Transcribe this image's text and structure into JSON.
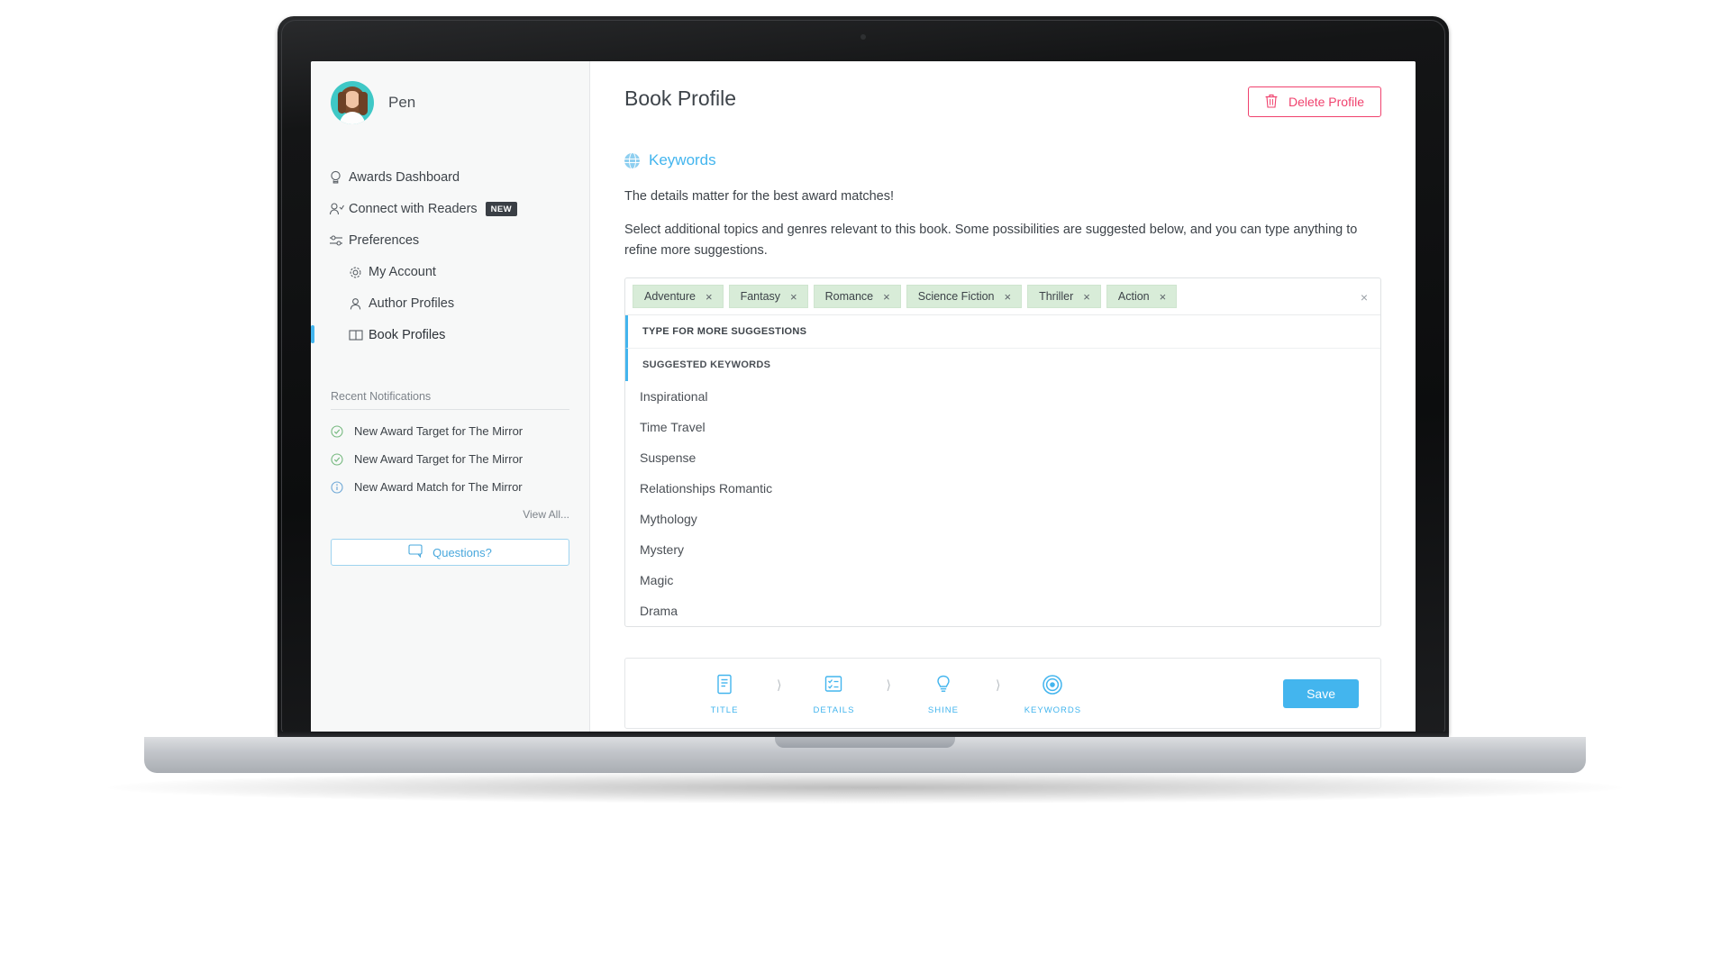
{
  "sidebar": {
    "profile_name": "Pen",
    "nav": [
      {
        "label": "Awards Dashboard",
        "icon": "award-icon",
        "active": false,
        "badge": ""
      },
      {
        "label": "Connect with Readers",
        "icon": "connect-readers-icon",
        "active": false,
        "badge": "NEW"
      },
      {
        "label": "Preferences",
        "icon": "preferences-sliders-icon",
        "active": false,
        "badge": ""
      }
    ],
    "sub_nav": [
      {
        "label": "My Account",
        "icon": "gear-icon",
        "active": false
      },
      {
        "label": "Author Profiles",
        "icon": "person-icon",
        "active": false
      },
      {
        "label": "Book Profiles",
        "icon": "book-icon",
        "active": true
      }
    ],
    "notifications_title": "Recent Notifications",
    "notifications": [
      {
        "label": "New Award Target for The Mirror",
        "icon": "check-circle-icon",
        "type": "success"
      },
      {
        "label": "New Award Target for The Mirror",
        "icon": "check-circle-icon",
        "type": "success"
      },
      {
        "label": "New Award Match for The Mirror",
        "icon": "info-circle-icon",
        "type": "info"
      }
    ],
    "view_all_label": "View All...",
    "questions_label": "Questions?",
    "questions_icon": "chat-bubble-icon"
  },
  "main": {
    "page_title": "Book Profile",
    "delete_button_label": "Delete Profile",
    "delete_icon": "trash-icon",
    "section_title": "Keywords",
    "section_icon": "globe-icon",
    "lead_text": "The details matter for the best award matches!",
    "help_text": "Select additional topics and genres relevant to this book. Some possibilities are suggested below, and you can type anything to refine more suggestions.",
    "tags": [
      "Adventure",
      "Fantasy",
      "Romance",
      "Science Fiction",
      "Thriller",
      "Action"
    ],
    "tag_remove_glyph": "×",
    "combo_clear_glyph": "×",
    "dropdown_heading": "TYPE FOR MORE SUGGESTIONS",
    "dropdown_subheading": "SUGGESTED KEYWORDS",
    "suggestions": [
      "Inspirational",
      "Time Travel",
      "Suspense",
      "Relationships Romantic",
      "Mythology",
      "Mystery",
      "Magic",
      "Drama"
    ]
  },
  "wizard": {
    "steps": [
      {
        "label": "TITLE",
        "icon": "document-title-icon"
      },
      {
        "label": "DETAILS",
        "icon": "checklist-details-icon"
      },
      {
        "label": "SHINE",
        "icon": "lightbulb-shine-icon"
      },
      {
        "label": "KEYWORDS",
        "icon": "target-keywords-icon"
      }
    ],
    "separator_glyph": "⟩",
    "save_label": "Save"
  },
  "colors": {
    "accent_blue": "#43b5ee",
    "danger_red": "#f0426e",
    "tag_green": "#d8ecd8",
    "avatar_teal": "#3fc8c6"
  }
}
